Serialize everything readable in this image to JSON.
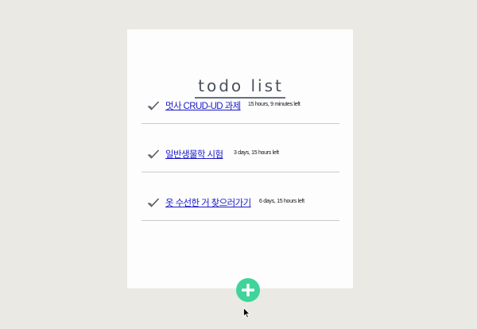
{
  "header": {
    "title": "todo list"
  },
  "todos": [
    {
      "text": "멋사 CRUD-UD 과제",
      "time_left": "15 hours, 9 minutes left"
    },
    {
      "text": "일반생물학 시험",
      "time_left": "3 days, 15 hours left"
    },
    {
      "text": "옷 수선한 거 찾으러가기",
      "time_left": "6 days, 15 hours left"
    }
  ],
  "icons": {
    "check": "checkmark-icon",
    "add": "plus-icon",
    "pointer": "mouse-pointer-icon"
  },
  "colors": {
    "page_background": "#ebe9e3",
    "card_background": "#fdfdfe",
    "link": "#1a1ac8",
    "add_button": "#3fd49a"
  }
}
